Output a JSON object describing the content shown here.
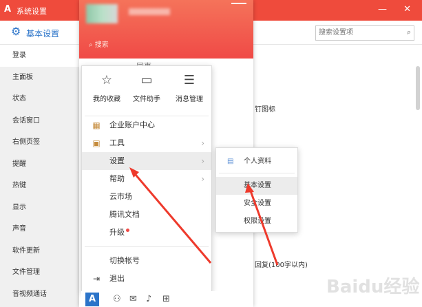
{
  "window": {
    "title": "系统设置",
    "logo": "A",
    "controls": "—  ✕"
  },
  "settings": {
    "title": "基本设置",
    "search_placeholder": "搜索设置项"
  },
  "sidebar": {
    "items": [
      {
        "label": "登录"
      },
      {
        "label": "主面板"
      },
      {
        "label": "状态"
      },
      {
        "label": "会话窗口"
      },
      {
        "label": "右侧页签"
      },
      {
        "label": "提醒"
      },
      {
        "label": "热键"
      },
      {
        "label": "显示"
      },
      {
        "label": "声音"
      },
      {
        "label": "软件更新"
      },
      {
        "label": "文件管理"
      },
      {
        "label": "音视频通话"
      }
    ]
  },
  "main": {
    "fragments": [
      {
        "text": "钉图标"
      },
      {
        "text": "回复(100字以内)"
      }
    ]
  },
  "chat": {
    "search_placeholder": "搜索",
    "tab_contacts": "同事",
    "add": "+"
  },
  "menu": {
    "quick": [
      {
        "icon": "star-bookmark-icon",
        "glyph": "☆",
        "label": "我的收藏"
      },
      {
        "icon": "folder-icon",
        "glyph": "▭",
        "label": "文件助手"
      },
      {
        "icon": "message-icon",
        "glyph": "☰",
        "label": "消息管理"
      }
    ],
    "items": [
      {
        "label": "企业账户中心",
        "icon": "enterprise-icon",
        "glyph": "▦"
      },
      {
        "label": "工具",
        "icon": "toolbox-icon",
        "glyph": "▣",
        "arrow": "›"
      },
      {
        "label": "设置",
        "arrow": "›"
      },
      {
        "label": "帮助",
        "arrow": "›"
      },
      {
        "label": "云市场"
      },
      {
        "label": "腾讯文档"
      },
      {
        "label": "升级"
      }
    ],
    "switch": "切换帐号",
    "logout": "退出",
    "logout_glyph": "⇥"
  },
  "submenu": {
    "items": [
      {
        "label": "个人资料",
        "glyph": "▤"
      },
      {
        "label": "基本设置"
      },
      {
        "label": "安全设置"
      },
      {
        "label": "权限设置"
      }
    ]
  },
  "bottom": {
    "logo": "A",
    "icons": [
      {
        "name": "add-contact-icon",
        "glyph": "⚇"
      },
      {
        "name": "mail-icon",
        "glyph": "✉"
      },
      {
        "name": "speaker-icon",
        "glyph": "♪"
      },
      {
        "name": "apps-grid-icon",
        "glyph": "⊞"
      }
    ]
  },
  "watermark": "Baidu经验"
}
